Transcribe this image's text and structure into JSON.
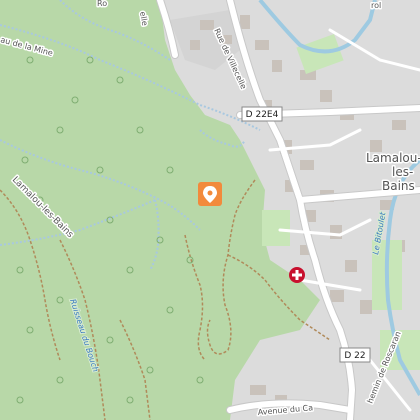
{
  "map": {
    "colors": {
      "forest": "#b8d8a8",
      "urban": "#dcdcdc",
      "road": "#ffffff",
      "road_edge": "#c8c8c8",
      "path": "#a8c8e0",
      "track": "#b08a5a",
      "water": "#9ecae1",
      "park": "#c8e6b8",
      "pin": "#f28a3c",
      "hospital": "#c8102e"
    },
    "labels": {
      "town": "Lamalou-les-Bains",
      "town_line1": "Lamalou-",
      "town_line2": "les-",
      "town_line3": "Bains",
      "area_west": "Lamalou-les-Bains",
      "street_rue_ville": "Rue de Villecelle",
      "street_ruisseau_mine": "au de la Mine",
      "street_top_left": "Ro",
      "street_top_mid": "elle",
      "street_top_right": "rol",
      "stream_bouch": "Ruisseau du Bouch",
      "stream_bitoulet": "Le Bitoulet",
      "road_d22e4": "D 22E4",
      "road_d22": "D 22",
      "avenue": "Avenue du Ca",
      "chemin": "hemin de Roscaran"
    },
    "markers": {
      "pin_icon": "location-pin-icon",
      "hospital_icon": "hospital-cross-icon"
    }
  }
}
